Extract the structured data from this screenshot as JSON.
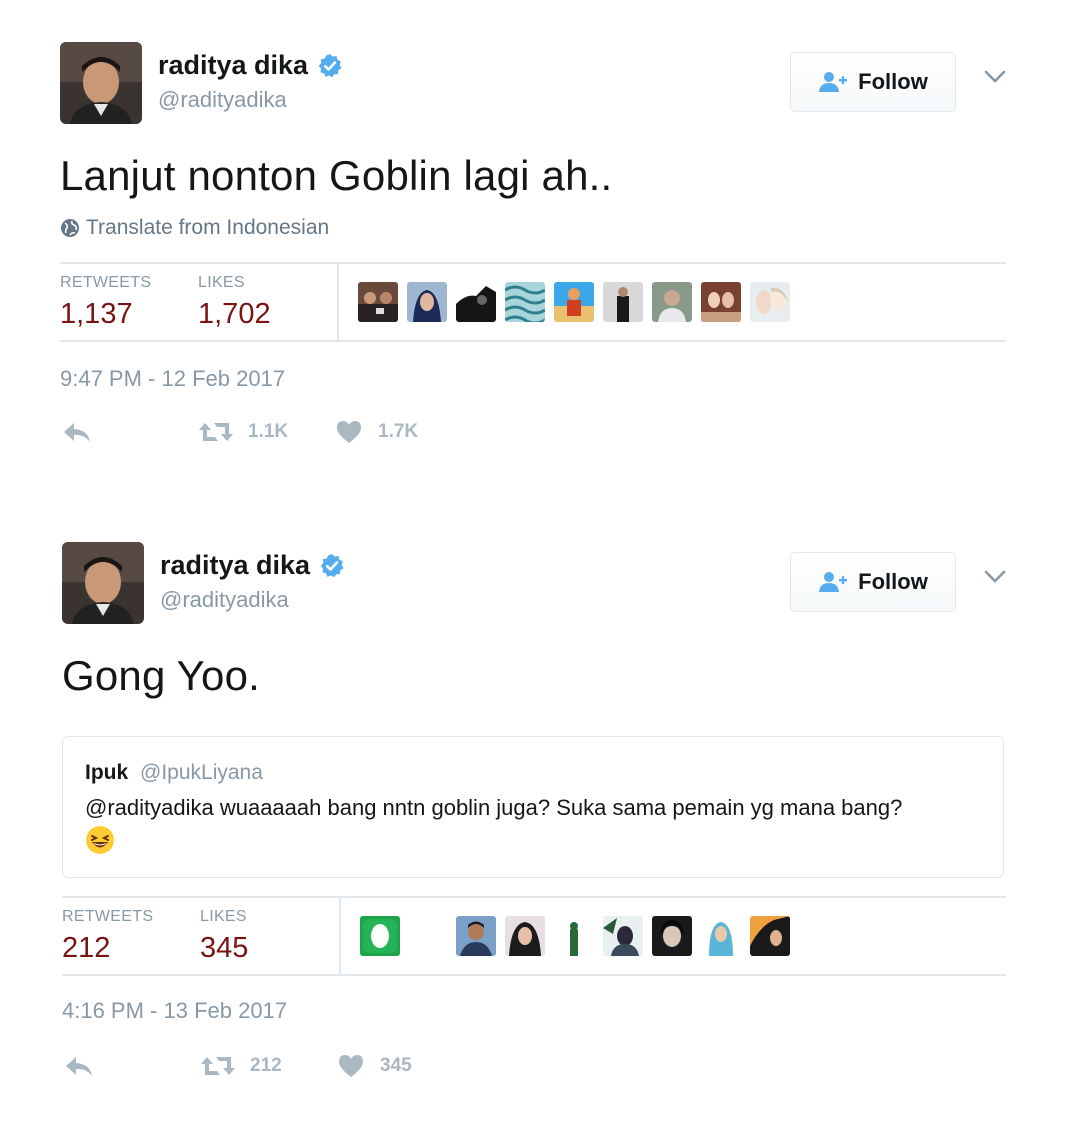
{
  "tweets": [
    {
      "author": {
        "name": "raditya dika",
        "handle": "@radityadika"
      },
      "follow_label": "Follow",
      "text": "Lanjut nonton Goblin lagi ah..",
      "translate_label": "Translate from Indonesian",
      "stats": {
        "retweets_label": "RETWEETS",
        "retweets": "1,137",
        "likes_label": "LIKES",
        "likes": "1,702"
      },
      "timestamp": "9:47 PM - 12 Feb 2017",
      "actions": {
        "retweet_count": "1.1K",
        "like_count": "1.7K"
      }
    },
    {
      "author": {
        "name": "raditya dika",
        "handle": "@radityadika"
      },
      "follow_label": "Follow",
      "text": "Gong Yoo.",
      "quote": {
        "name": "Ipuk",
        "handle": "@IpukLiyana",
        "text": "@radityadika wuaaaaah bang nntn goblin juga? Suka sama pemain yg mana bang?"
      },
      "stats": {
        "retweets_label": "RETWEETS",
        "retweets": "212",
        "likes_label": "LIKES",
        "likes": "345"
      },
      "timestamp": "4:16 PM - 13 Feb 2017",
      "actions": {
        "retweet_count": "212",
        "like_count": "345"
      }
    }
  ],
  "colors": {
    "verified": "#55acee",
    "stat_value": "#7a1414",
    "muted": "#8899a6",
    "action_icon": "#aab8c2"
  },
  "icons": {
    "verified": "verified-badge-icon",
    "follow": "add-user-icon",
    "caret": "chevron-down-icon",
    "translate": "globe-icon",
    "reply": "reply-icon",
    "retweet": "retweet-icon",
    "like": "heart-icon",
    "emoji": "laughing-emoji-icon"
  }
}
